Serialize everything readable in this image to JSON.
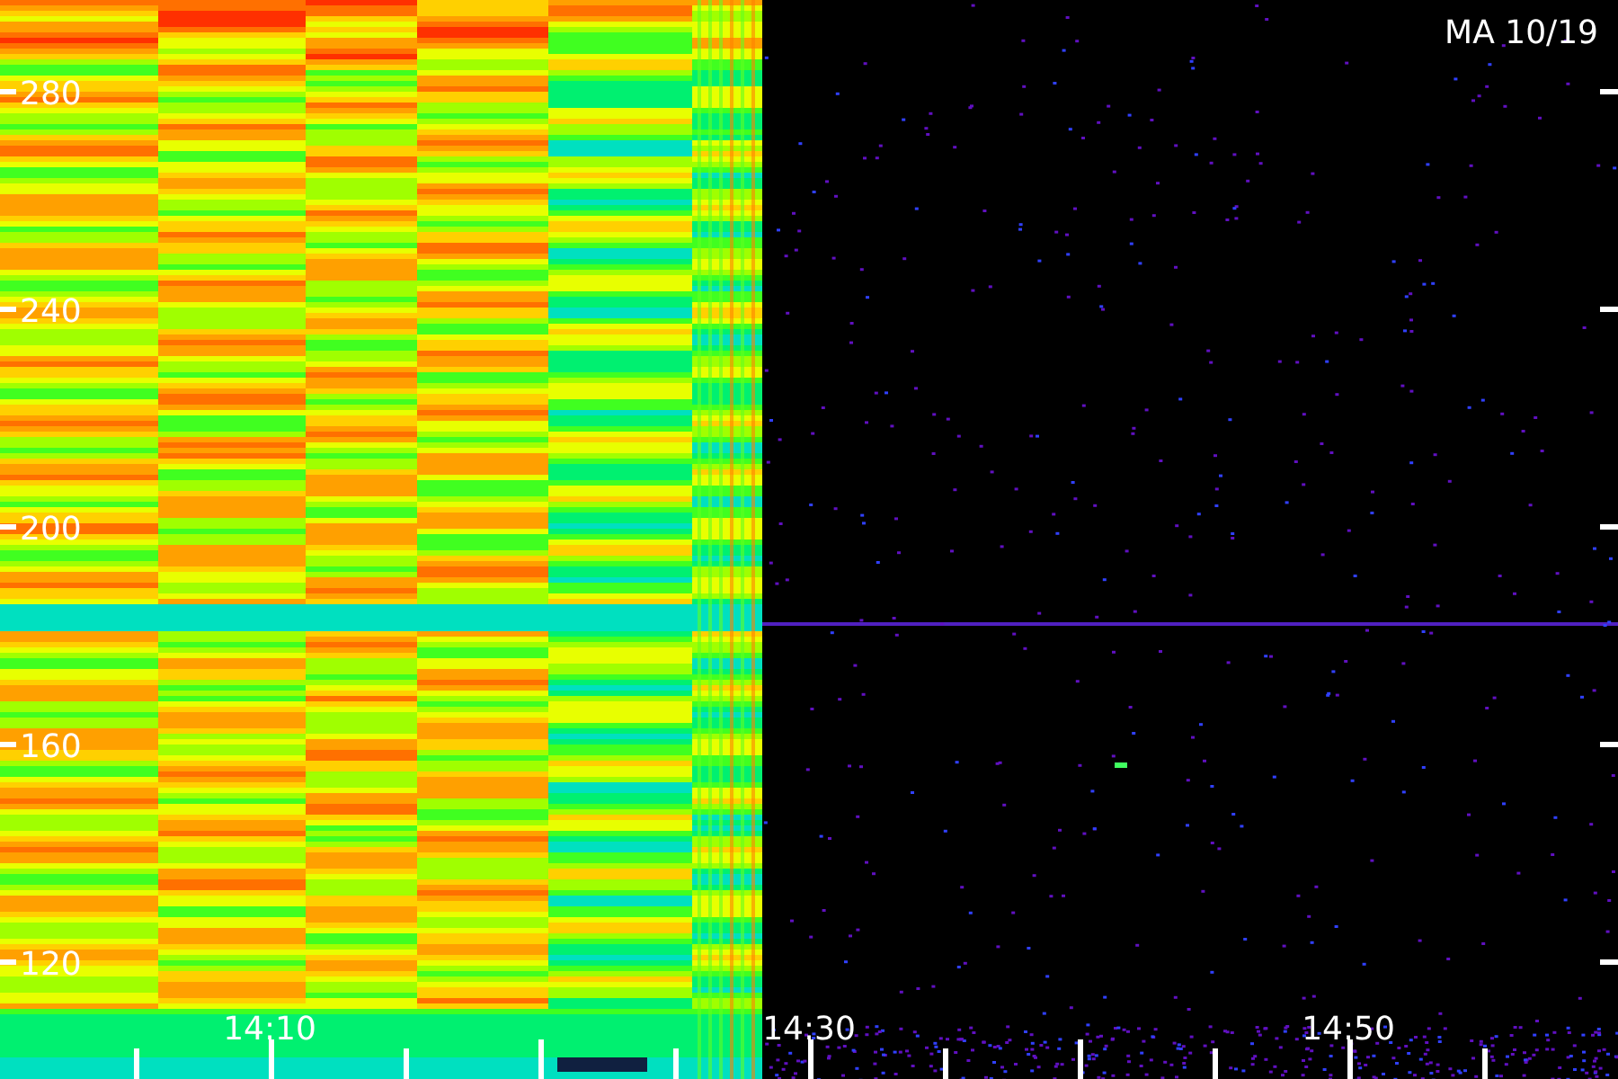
{
  "plot": {
    "title": "MA 10/19",
    "y_ticks": [
      "280",
      "240",
      "200",
      "160",
      "120"
    ],
    "x_ticks": [
      "14:10",
      "14:30",
      "14:50"
    ]
  }
}
